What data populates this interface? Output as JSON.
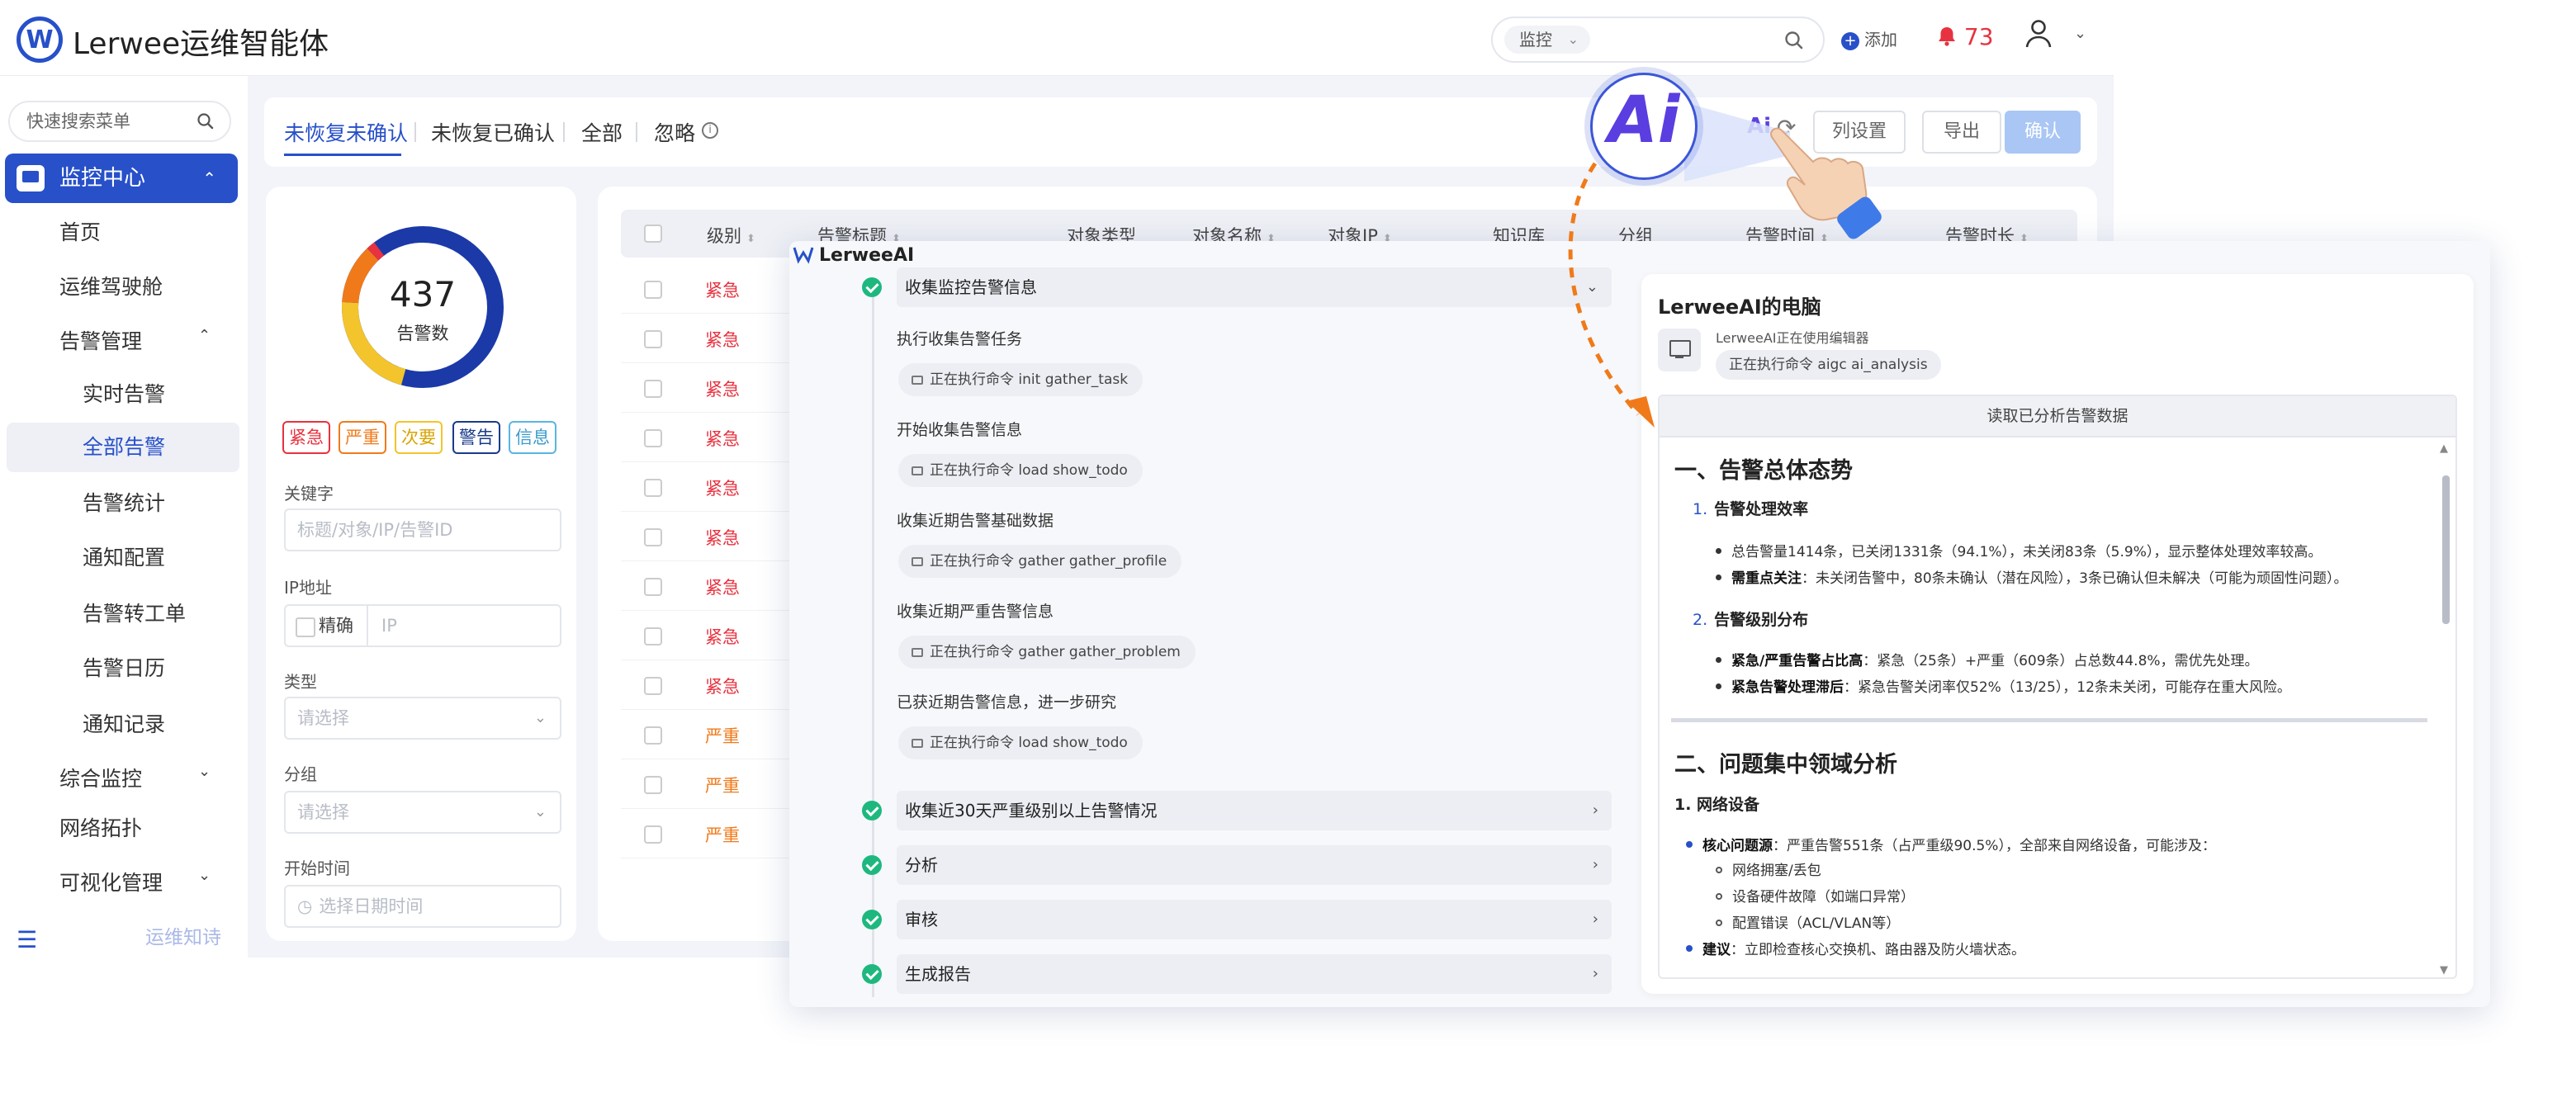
{
  "header": {
    "app_title": "Lerwee运维智能体",
    "logo_glyph": "W",
    "search_select": "监控",
    "add_label": "添加",
    "notification_count": "73"
  },
  "sidebar": {
    "search_placeholder": "快速搜索菜单",
    "items": [
      {
        "label": "监控中心"
      },
      {
        "label": "首页"
      },
      {
        "label": "运维驾驶舱"
      },
      {
        "label": "告警管理"
      },
      {
        "label": "实时告警"
      },
      {
        "label": "全部告警"
      },
      {
        "label": "告警统计"
      },
      {
        "label": "通知配置"
      },
      {
        "label": "告警转工单"
      },
      {
        "label": "告警日历"
      },
      {
        "label": "通知记录"
      },
      {
        "label": "综合监控"
      },
      {
        "label": "网络拓扑"
      },
      {
        "label": "可视化管理"
      }
    ],
    "footer_text": "运维知诗"
  },
  "tabs": [
    {
      "label": "未恢复未确认"
    },
    {
      "label": "未恢复已确认"
    },
    {
      "label": "全部"
    },
    {
      "label": "忽略"
    }
  ],
  "toolbar": {
    "ai_label": "Ai",
    "columns_button": "列设置",
    "export_button": "导出",
    "confirm_button": "确认"
  },
  "filters": {
    "total_count": "437",
    "total_label": "告警数",
    "severity_chips": [
      "紧急",
      "严重",
      "次要",
      "警告",
      "信息"
    ],
    "keyword_label": "关键字",
    "keyword_placeholder": "标题/对象/IP/告警ID",
    "ip_label": "IP地址",
    "ip_exact": "精确",
    "ip_placeholder": "IP",
    "type_label": "类型",
    "type_placeholder": "请选择",
    "group_label": "分组",
    "group_placeholder": "请选择",
    "start_label": "开始时间",
    "start_placeholder": "选择日期时间"
  },
  "table": {
    "headers": [
      "级别",
      "告警标题",
      "对象类型",
      "对象名称",
      "对象IP",
      "知识库",
      "分组",
      "告警时间",
      "告警时长"
    ],
    "rows": [
      "紧急",
      "紧急",
      "紧急",
      "紧急",
      "紧急",
      "紧急",
      "紧急",
      "紧急",
      "紧急",
      "严重",
      "严重",
      "严重"
    ]
  },
  "ai_panel": {
    "brand": "LerweeAI",
    "steps": [
      {
        "title": "收集监控告警信息",
        "expanded": true
      },
      {
        "title": "收集近30天严重级别以上告警情况"
      },
      {
        "title": "分析"
      },
      {
        "title": "审核"
      },
      {
        "title": "生成报告"
      }
    ],
    "substeps": [
      {
        "title": "执行收集告警任务",
        "command": "正在执行命令 init gather_task"
      },
      {
        "title": "开始收集告警信息",
        "command": "正在执行命令 load show_todo"
      },
      {
        "title": "收集近期告警基础数据",
        "command": "正在执行命令 gather gather_profile"
      },
      {
        "title": "收集近期严重告警信息",
        "command": "正在执行命令 gather gather_problem"
      },
      {
        "title": "已获近期告警信息，进一步研究",
        "command": "正在执行命令 load show_todo"
      }
    ]
  },
  "computer_panel": {
    "title": "LerweeAI的电脑",
    "subtitle": "LerweeAI正在使用编辑器",
    "command": "正在执行命令 aigc ai_analysis",
    "doc_header": "读取已分析告警数据",
    "doc": {
      "h1_a": "一、告警总体态势",
      "s1_title": "告警处理效率",
      "s1_num": "1.",
      "s1_b1": "总告警量1414条，已关闭1331条（94.1%），未关闭83条（5.9%），显示整体处理效率较高。",
      "s1_b2_key": "需重点关注",
      "s1_b2": "：未关闭告警中，80条未确认（潜在风险），3条已确认但未解决（可能为顽固性问题）。",
      "s2_title": "告警级别分布",
      "s2_num": "2.",
      "s2_b1_key": "紧急/严重告警占比高",
      "s2_b1": "：紧急（25条）+严重（609条）占总数44.8%，需优先处理。",
      "s2_b2_key": "紧急告警处理滞后",
      "s2_b2": "：紧急告警关闭率仅52%（13/25），12条未关闭，可能存在重大风险。",
      "h1_b": "二、问题集中领域分析",
      "s3_title": "1. 网络设备",
      "s3_b1_key": "核心问题源",
      "s3_b1": "：严重告警551条（占严重级90.5%），全部来自网络设备，可能涉及：",
      "s3_c1": "网络拥塞/丢包",
      "s3_c2": "设备硬件故障（如端口异常）",
      "s3_c3": "配置错误（ACL/VLAN等）",
      "s3_b2_key": "建议",
      "s3_b2": "：立即检查核心交换机、路由器及防火墙状态。"
    }
  },
  "badge": {
    "text": "Ai"
  },
  "colors": {
    "primary": "#2750c9",
    "critical": "#e8323f",
    "severe": "#f07a1a",
    "minor": "#f3c42b",
    "warning": "#1a3a8c",
    "info": "#58b6e0",
    "success": "#1eb87f",
    "arrow": "#f07a1a"
  }
}
